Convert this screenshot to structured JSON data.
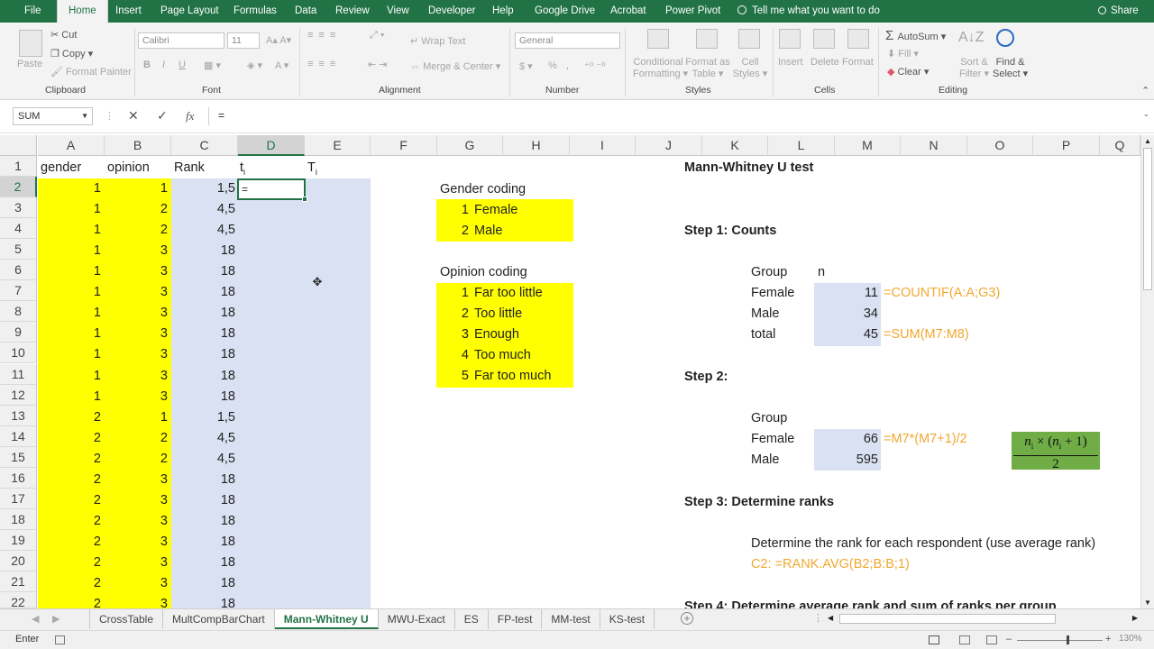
{
  "ribbon_tabs": [
    "File",
    "Home",
    "Insert",
    "Page Layout",
    "Formulas",
    "Data",
    "Review",
    "View",
    "Developer",
    "Help",
    "Google Drive",
    "Acrobat",
    "Power Pivot"
  ],
  "tell_me": "Tell me what you want to do",
  "share": "Share",
  "ribbon": {
    "paste": "Paste",
    "cut": "Cut",
    "copy": "Copy",
    "format_painter": "Format Painter",
    "clipboard": "Clipboard",
    "font_name": "Calibri",
    "font_size": "11",
    "font": "Font",
    "wrap_text": "Wrap Text",
    "merge_center": "Merge & Center",
    "alignment": "Alignment",
    "number_format": "General",
    "number": "Number",
    "pct": "%",
    "comma": ",",
    "cond_fmt1": "Conditional",
    "cond_fmt2": "Formatting",
    "fmt_table1": "Format as",
    "fmt_table2": "Table",
    "cell_styles1": "Cell",
    "cell_styles2": "Styles",
    "styles": "Styles",
    "insert": "Insert",
    "delete": "Delete",
    "format": "Format",
    "cells": "Cells",
    "autosum": "AutoSum",
    "fill": "Fill",
    "clear": "Clear",
    "sort1": "Sort &",
    "sort2": "Filter",
    "find1": "Find &",
    "find2": "Select",
    "editing": "Editing",
    "bold": "B",
    "italic": "I",
    "underline": "U"
  },
  "formula_bar": {
    "name_box": "SUM",
    "formula": "="
  },
  "columns": [
    "A",
    "B",
    "C",
    "D",
    "E",
    "F",
    "G",
    "H",
    "I",
    "J",
    "K",
    "L",
    "M",
    "N",
    "O",
    "P",
    "Q"
  ],
  "rows": [
    "1",
    "2",
    "3",
    "4",
    "5",
    "6",
    "7",
    "8",
    "9",
    "10",
    "11",
    "12",
    "13",
    "14",
    "15",
    "16",
    "17",
    "18",
    "19",
    "20",
    "21",
    "22"
  ],
  "headers": {
    "a": "gender",
    "b": "opinion",
    "c": "Rank",
    "d": "t",
    "d_sub": "i",
    "e": "T",
    "e_sub": "i"
  },
  "data_rows": [
    {
      "a": "1",
      "b": "1",
      "c": "1,5"
    },
    {
      "a": "1",
      "b": "2",
      "c": "4,5"
    },
    {
      "a": "1",
      "b": "2",
      "c": "4,5"
    },
    {
      "a": "1",
      "b": "3",
      "c": "18"
    },
    {
      "a": "1",
      "b": "3",
      "c": "18"
    },
    {
      "a": "1",
      "b": "3",
      "c": "18"
    },
    {
      "a": "1",
      "b": "3",
      "c": "18"
    },
    {
      "a": "1",
      "b": "3",
      "c": "18"
    },
    {
      "a": "1",
      "b": "3",
      "c": "18"
    },
    {
      "a": "1",
      "b": "3",
      "c": "18"
    },
    {
      "a": "1",
      "b": "3",
      "c": "18"
    },
    {
      "a": "2",
      "b": "1",
      "c": "1,5"
    },
    {
      "a": "2",
      "b": "2",
      "c": "4,5"
    },
    {
      "a": "2",
      "b": "2",
      "c": "4,5"
    },
    {
      "a": "2",
      "b": "3",
      "c": "18"
    },
    {
      "a": "2",
      "b": "3",
      "c": "18"
    },
    {
      "a": "2",
      "b": "3",
      "c": "18"
    },
    {
      "a": "2",
      "b": "3",
      "c": "18"
    },
    {
      "a": "2",
      "b": "3",
      "c": "18"
    },
    {
      "a": "2",
      "b": "3",
      "c": "18"
    },
    {
      "a": "2",
      "b": "3",
      "c": "18"
    }
  ],
  "active_cell_value": "=",
  "gender_coding": {
    "title": "Gender coding",
    "items": [
      {
        "code": "1",
        "label": "Female"
      },
      {
        "code": "2",
        "label": "Male"
      }
    ]
  },
  "opinion_coding": {
    "title": "Opinion coding",
    "items": [
      {
        "code": "1",
        "label": "Far too little"
      },
      {
        "code": "2",
        "label": "Too little"
      },
      {
        "code": "3",
        "label": "Enough"
      },
      {
        "code": "4",
        "label": "Too much"
      },
      {
        "code": "5",
        "label": "Far too much"
      }
    ]
  },
  "mw": {
    "title": "Mann-Whitney U test",
    "step1": "Step 1: Counts",
    "group": "Group",
    "n": "n",
    "female": "Female",
    "male": "Male",
    "total": "total",
    "female_n": "11",
    "male_n": "34",
    "total_n": "45",
    "f_countif": "=COUNTIF(A:A;G3)",
    "f_sum": "=SUM(M7:M8)",
    "step2": "Step 2:",
    "female_v": "66",
    "male_v": "595",
    "f_m7": "=M7*(M7+1)/2",
    "eq_num": "n",
    "eq_sub": "i",
    "eq_times": " × (",
    "eq_plus": " + 1)",
    "eq_den": "2",
    "step3": "Step 3: Determine ranks",
    "step3_text": "Determine the rank for each respondent (use average rank)",
    "step3_formula": "C2: =RANK.AVG(B2;B:B;1)",
    "step4": "Step 4: Determine average rank and sum of ranks per group"
  },
  "sheet_tabs": [
    "CrossTable",
    "MultCompBarChart",
    "Mann-Whitney U",
    "MWU-Exact",
    "ES",
    "FP-test",
    "MM-test",
    "KS-test"
  ],
  "active_sheet": "Mann-Whitney U",
  "status": {
    "mode": "Enter",
    "zoom": "130%"
  },
  "colors": {
    "excel_green": "#217346",
    "yellow": "#ffff00",
    "lightblue": "#d9e1f2",
    "green_box": "#70ad47",
    "orange_text": "#f0a830"
  }
}
